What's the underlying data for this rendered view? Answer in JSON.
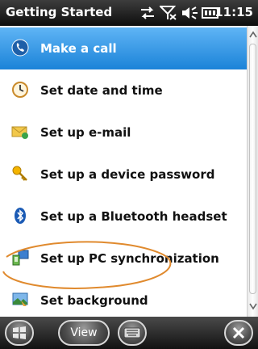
{
  "status_bar": {
    "title": "Getting Started",
    "time": "11:15",
    "icons": [
      "sync-icon",
      "no-signal-icon",
      "speaker-icon",
      "battery-icon"
    ]
  },
  "list": {
    "items": [
      {
        "label": "Make a call",
        "icon": "phone-icon",
        "selected": true
      },
      {
        "label": "Set date and time",
        "icon": "clock-icon"
      },
      {
        "label": "Set up e-mail",
        "icon": "envelope-icon"
      },
      {
        "label": "Set up a device password",
        "icon": "key-icon"
      },
      {
        "label": "Set up a Bluetooth headset",
        "icon": "bluetooth-icon"
      },
      {
        "label": "Set up PC synchronization",
        "icon": "pc-sync-icon"
      },
      {
        "label": "Set background",
        "icon": "background-icon"
      }
    ]
  },
  "softkeys": {
    "view_label": "View",
    "icons": [
      "windows-start-icon",
      "keyboard-icon",
      "close-icon"
    ]
  },
  "colors": {
    "selection": "#1b83d8",
    "annotation": "#e08a2e"
  }
}
